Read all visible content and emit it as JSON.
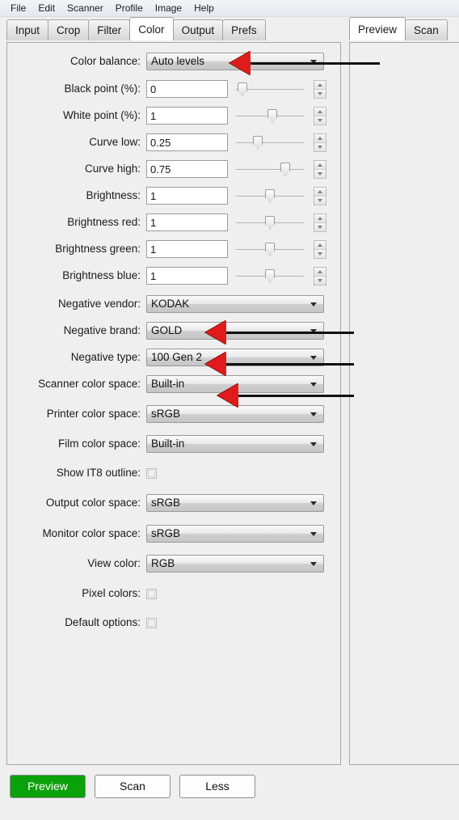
{
  "menubar": {
    "items": [
      "File",
      "Edit",
      "Scanner",
      "Profile",
      "Image",
      "Help"
    ]
  },
  "tabs": {
    "left": [
      {
        "label": "Input",
        "active": false
      },
      {
        "label": "Crop",
        "active": false
      },
      {
        "label": "Filter",
        "active": false
      },
      {
        "label": "Color",
        "active": true
      },
      {
        "label": "Output",
        "active": false
      },
      {
        "label": "Prefs",
        "active": false
      }
    ],
    "right": [
      {
        "label": "Preview",
        "active": true
      },
      {
        "label": "Scan",
        "active": false
      }
    ]
  },
  "form": {
    "color_balance": {
      "label": "Color balance:",
      "value": "Auto levels"
    },
    "black_point": {
      "label": "Black point (%):",
      "value": "0"
    },
    "white_point": {
      "label": "White point (%):",
      "value": "1"
    },
    "curve_low": {
      "label": "Curve low:",
      "value": "0.25"
    },
    "curve_high": {
      "label": "Curve high:",
      "value": "0.75"
    },
    "brightness": {
      "label": "Brightness:",
      "value": "1"
    },
    "brightness_red": {
      "label": "Brightness red:",
      "value": "1"
    },
    "brightness_green": {
      "label": "Brightness green:",
      "value": "1"
    },
    "brightness_blue": {
      "label": "Brightness blue:",
      "value": "1"
    },
    "negative_vendor": {
      "label": "Negative vendor:",
      "value": "KODAK"
    },
    "negative_brand": {
      "label": "Negative brand:",
      "value": "GOLD"
    },
    "negative_type": {
      "label": "Negative type:",
      "value": "100 Gen 2"
    },
    "scanner_color_space": {
      "label": "Scanner color space:",
      "value": "Built-in"
    },
    "printer_color_space": {
      "label": "Printer color space:",
      "value": "sRGB"
    },
    "film_color_space": {
      "label": "Film color space:",
      "value": "Built-in"
    },
    "show_it8_outline": {
      "label": "Show IT8 outline:",
      "checked": false
    },
    "output_color_space": {
      "label": "Output color space:",
      "value": "sRGB"
    },
    "monitor_color_space": {
      "label": "Monitor color space:",
      "value": "sRGB"
    },
    "view_color": {
      "label": "View color:",
      "value": "RGB"
    },
    "pixel_colors": {
      "label": "Pixel colors:",
      "checked": false
    },
    "default_options": {
      "label": "Default options:",
      "checked": false
    }
  },
  "buttons": {
    "preview": "Preview",
    "scan": "Scan",
    "less": "Less"
  },
  "colors": {
    "primary_button": "#0aa10a",
    "annotation_arrow": "#e01b1b",
    "annotation_line": "#101010",
    "panel_background": "#efeff0"
  }
}
